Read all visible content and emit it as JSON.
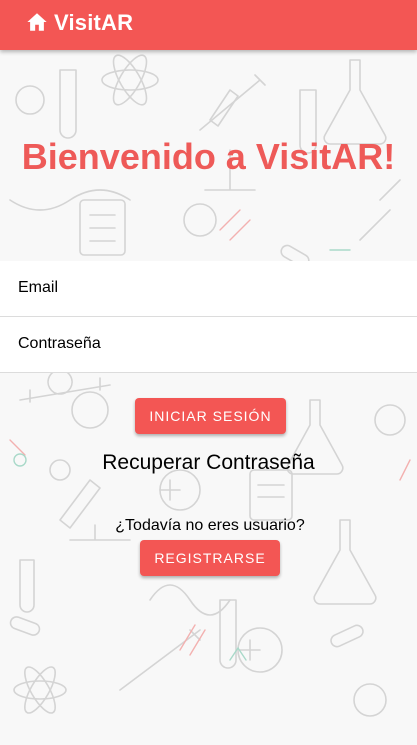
{
  "app": {
    "title": "VisitAR",
    "accent_color": "#f35654",
    "home_icon": "home-icon",
    "background_pattern": "medical-science-doodles"
  },
  "welcome": {
    "heading": "Bienvenido a VisitAR!"
  },
  "form": {
    "email_placeholder": "Email",
    "password_placeholder": "Contraseña",
    "login_label": "Iniciar sesión",
    "recover_label": "Recuperar Contraseña",
    "not_user_text": "¿Todavía no eres usuario?",
    "register_label": "Registrarse"
  }
}
